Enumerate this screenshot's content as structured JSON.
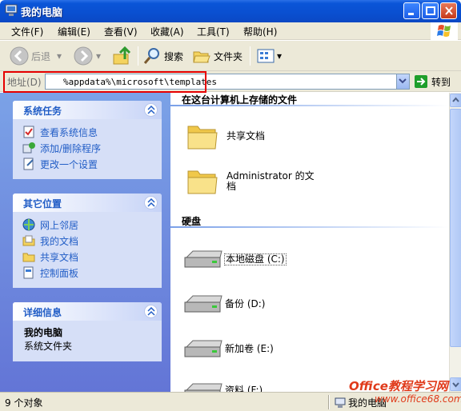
{
  "window": {
    "title": "我的电脑"
  },
  "menu": [
    "文件(F)",
    "编辑(E)",
    "查看(V)",
    "收藏(A)",
    "工具(T)",
    "帮助(H)"
  ],
  "toolbar": {
    "back": "后退",
    "search": "搜索",
    "folders": "文件夹"
  },
  "address": {
    "label": "地址(D)",
    "value": "%appdata%\\microsoft\\templates",
    "go": "转到"
  },
  "tasks": {
    "system": {
      "title": "系统任务",
      "items": [
        "查看系统信息",
        "添加/删除程序",
        "更改一个设置"
      ]
    },
    "places": {
      "title": "其它位置",
      "items": [
        "网上邻居",
        "我的文档",
        "共享文档",
        "控制面板"
      ]
    },
    "details": {
      "title": "详细信息",
      "name": "我的电脑",
      "sub": "系统文件夹"
    }
  },
  "content": {
    "files_section": "在这台计算机上存储的文件",
    "files": [
      "共享文档",
      "Administrator 的文档"
    ],
    "drives_section": "硬盘",
    "drives": [
      "本地磁盘 (C:)",
      "备份 (D:)",
      "新加卷 (E:)",
      "资料 (F:)"
    ]
  },
  "status": {
    "count": "9 个对象",
    "location": "我的电脑"
  },
  "watermark": {
    "title": "Office教程学习网",
    "url": "www.office68.com"
  },
  "colors": {
    "titlebar": "#0a55d8",
    "taskpane": "#6375d6",
    "highlight": "#e60000",
    "link": "#215dc6"
  }
}
